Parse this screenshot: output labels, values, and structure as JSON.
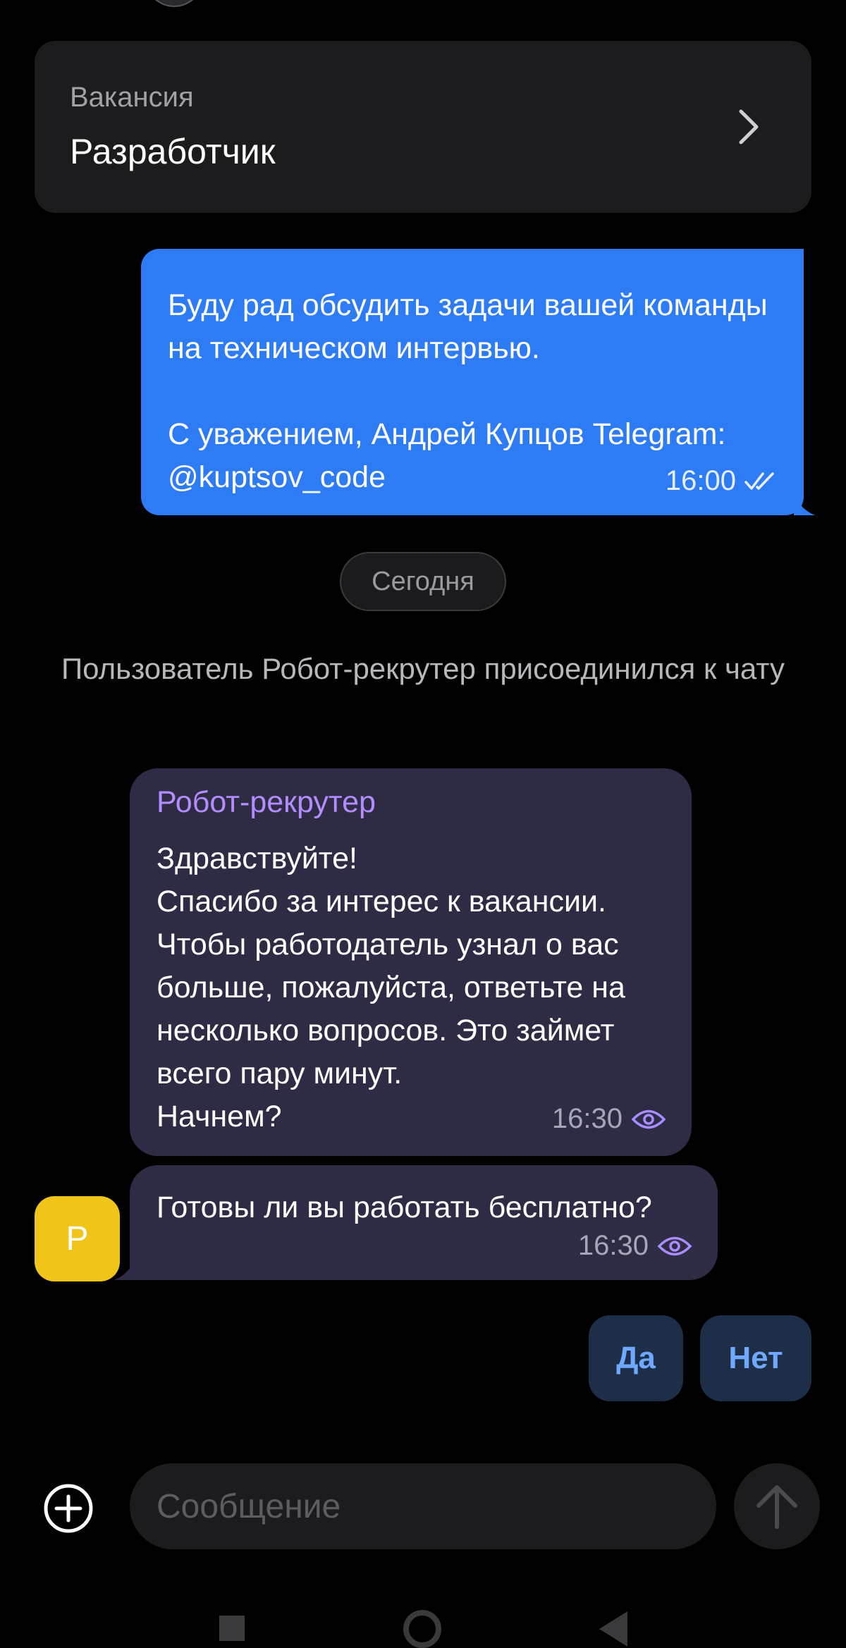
{
  "vacancy": {
    "label": "Вакансия",
    "title": "Разработчик"
  },
  "outgoing_message": {
    "text": "Буду рад обсудить задачи вашей команды на техническом интервью.\n\nС уважением, Андрей Купцов Telegram: @kuptsov_code",
    "time": "16:00",
    "status_icon": "double-check-icon"
  },
  "date_separator": "Сегодня",
  "system_message": "Пользователь Робот-рекрутер присоединился к чату",
  "incoming_messages": [
    {
      "sender": "Робот-рекрутер",
      "text": "Здравствуйте!\nСпасибо за интерес к вакансии. Чтобы работодатель узнал о вас больше, пожалуйста, ответьте на несколько вопросов. Это займет всего пару минут.\nНачнем?",
      "time": "16:30",
      "status_icon": "eye-icon"
    },
    {
      "text": "Готовы ли вы работать бесплатно?",
      "time": "16:30",
      "status_icon": "eye-icon"
    }
  ],
  "sender_avatar": {
    "initial": "Р",
    "color": "#f0c419"
  },
  "quick_replies": {
    "yes": "Да",
    "no": "Нет"
  },
  "composer": {
    "placeholder": "Сообщение",
    "add_icon": "plus-circle-icon",
    "send_icon": "arrow-up-icon"
  },
  "colors": {
    "background": "#000000",
    "outgoing_bubble": "#2d7cf6",
    "incoming_bubble": "#2e2c45",
    "sender_name": "#b38cff",
    "quick_reply_text": "#6ea8ff"
  }
}
